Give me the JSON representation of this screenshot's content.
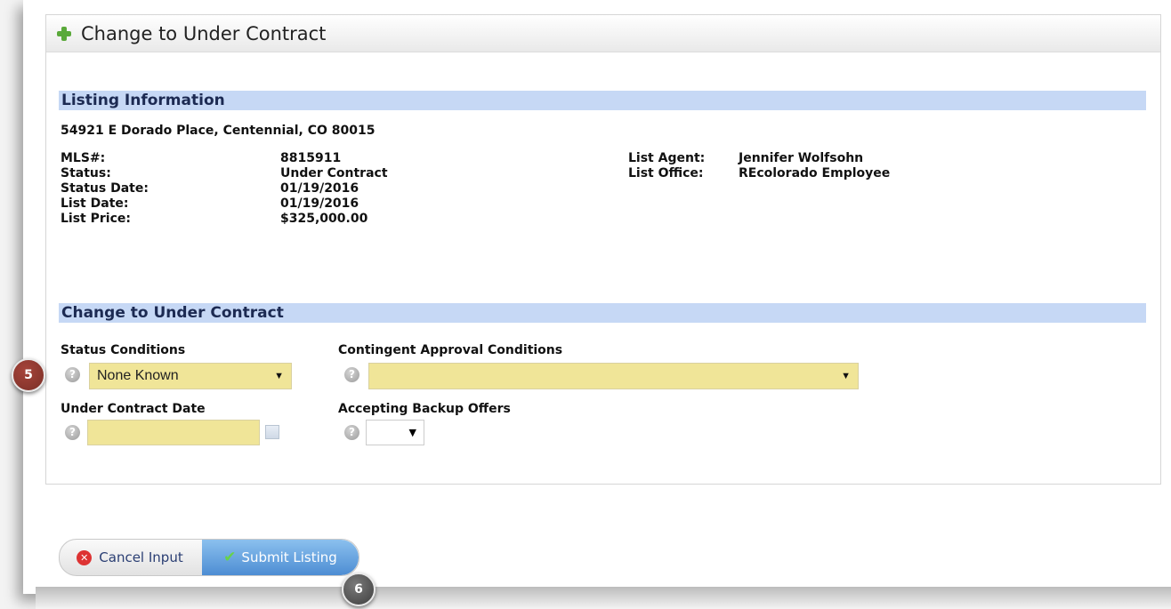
{
  "panel": {
    "title": "Change to Under Contract"
  },
  "listing": {
    "section_title": "Listing Information",
    "address": "54921 E Dorado Place, Centennial, CO 80015",
    "left_fields": [
      {
        "label": "MLS#:",
        "value": "8815911"
      },
      {
        "label": "Status:",
        "value": "Under Contract"
      },
      {
        "label": "Status Date:",
        "value": "01/19/2016"
      },
      {
        "label": "List Date:",
        "value": "01/19/2016"
      },
      {
        "label": "List Price:",
        "value": "$325,000.00"
      }
    ],
    "right_fields": [
      {
        "label": "List Agent:",
        "value": "Jennifer Wolfsohn"
      },
      {
        "label": "List Office:",
        "value": "REcolorado Employee"
      }
    ]
  },
  "form": {
    "section_title": "Change to Under Contract",
    "status_conditions_label": "Status Conditions",
    "status_conditions_value": "None Known",
    "contingent_label": "Contingent Approval Conditions",
    "contingent_value": "",
    "under_contract_date_label": "Under Contract Date",
    "under_contract_date_value": "",
    "backup_offers_label": "Accepting Backup Offers",
    "backup_offers_value": "",
    "help_glyph": "?",
    "arrow_glyph": "▼"
  },
  "buttons": {
    "cancel_label": "Cancel Input",
    "cancel_glyph": "✕",
    "submit_label": "Submit Listing",
    "submit_glyph": "✔"
  },
  "callouts": {
    "five": "5",
    "six": "6"
  },
  "colors": {
    "section_bar": "#c6d8f5",
    "field_yellow": "#f0e598",
    "submit_blue": "#4d8dd3"
  }
}
